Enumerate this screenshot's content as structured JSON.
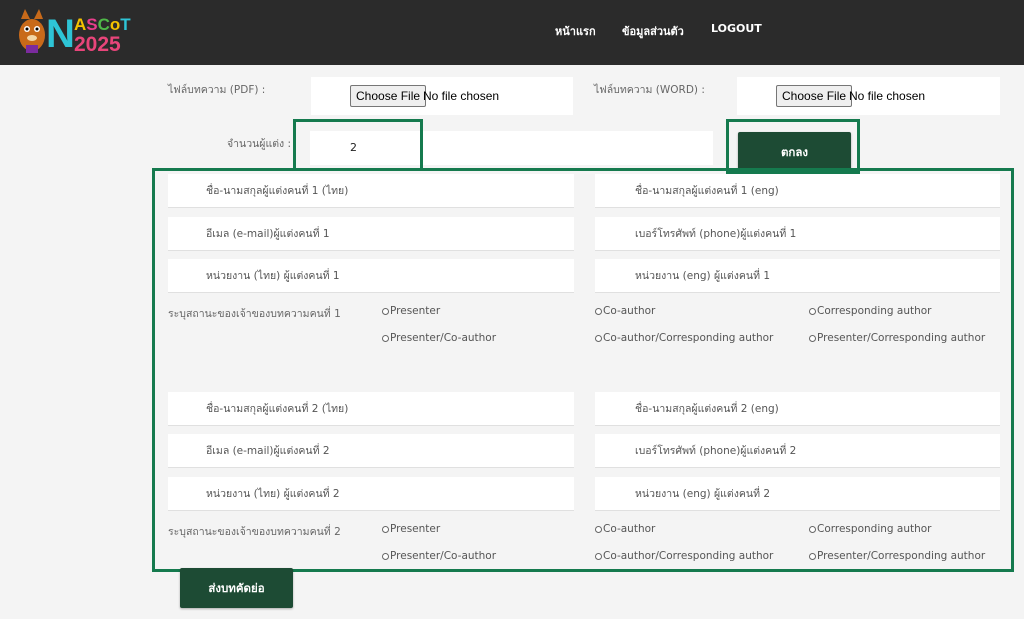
{
  "header": {
    "logo_text_1": "NASCoT",
    "logo_text_2": "2025",
    "nav": [
      "หน้าแรก",
      "ข้อมูลส่วนตัว",
      "LOGOUT"
    ]
  },
  "upload": {
    "pdf_label": "ไฟล์บทความ (PDF) :",
    "word_label": "ไฟล์บทความ (WORD) :",
    "choose_file": "Choose File",
    "no_file": "No file chosen",
    "author_count_label": "จำนวนผู้แต่ง :",
    "author_count_value": "2",
    "confirm_button": "ตกลง"
  },
  "authors": [
    {
      "name_th": "ชื่อ-นามสกุลผู้แต่งคนที่ 1 (ไทย)",
      "name_en": "ชื่อ-นามสกุลผู้แต่งคนที่ 1  (eng)",
      "email": "อีเมล (e-mail)ผู้แต่งคนที่ 1",
      "phone": "เบอร์โทรศัพท์ (phone)ผู้แต่งคนที่ 1",
      "org_th": "หน่วยงาน (ไทย) ผู้แต่งคนที่ 1",
      "org_en": "หน่วยงาน (eng) ผู้แต่งคนที่ 1",
      "status_label": "ระบุสถานะของเจ้าของบทความคนที่ 1"
    },
    {
      "name_th": "ชื่อ-นามสกุลผู้แต่งคนที่ 2 (ไทย)",
      "name_en": "ชื่อ-นามสกุลผู้แต่งคนที่ 2  (eng)",
      "email": "อีเมล (e-mail)ผู้แต่งคนที่ 2",
      "phone": "เบอร์โทรศัพท์ (phone)ผู้แต่งคนที่ 2",
      "org_th": "หน่วยงาน (ไทย) ผู้แต่งคนที่ 2",
      "org_en": "หน่วยงาน (eng) ผู้แต่งคนที่ 2",
      "status_label": "ระบุสถานะของเจ้าของบทความคนที่ 2"
    }
  ],
  "roles": [
    "Presenter",
    "Co-author",
    "Corresponding author",
    "Presenter/Co-author",
    "Co-author/Corresponding author",
    "Presenter/Corresponding author"
  ],
  "submit_button": "ส่งบทคัดย่อ",
  "colors": {
    "accent_green": "#157a4e",
    "button_dark_green": "#1d4b34",
    "navbar": "#2b2b2b"
  }
}
